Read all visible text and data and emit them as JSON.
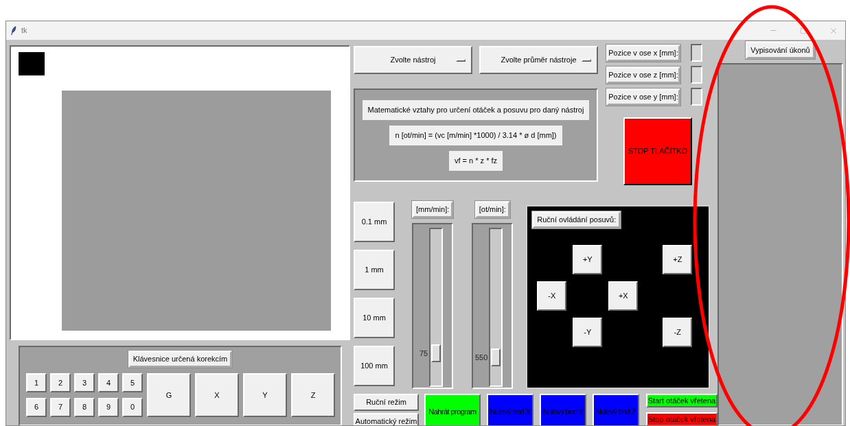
{
  "window": {
    "title": "tk"
  },
  "tool_dropdowns": [
    {
      "label": "Zvolte nástroj"
    },
    {
      "label": "Zvolte průměr nástroje"
    }
  ],
  "formulas": [
    "Matematické vztahy pro určení otáček a posuvu pro daný nástroj",
    "n [ot/min] = (vc [m/min] *1000) / 3.14 * ø d [mm])",
    "vf = n * z * fz"
  ],
  "positions": [
    {
      "label": "Pozice v ose x [mm]:"
    },
    {
      "label": "Pozice v ose z [mm]:"
    },
    {
      "label": "Pozice v ose y [mm]:"
    }
  ],
  "stop_button": "STOP TLAČÍTKO",
  "step_buttons": [
    "0.1 mm",
    "1 mm",
    "10 mm",
    "100 mm"
  ],
  "sliders": [
    {
      "unit": "[mm/min]:",
      "value": "75",
      "level": 0.83
    },
    {
      "unit": "[ot/min]:",
      "value": "550",
      "level": 0.86
    }
  ],
  "manual_jog": {
    "title": "Ruční ovládání posuvů:",
    "buttons": [
      "+Y",
      "+Z",
      "-X",
      "+X",
      "-Y",
      "-Z"
    ]
  },
  "keypad": {
    "title": "Klávesnice určená korekcím",
    "digit_keys": [
      "1",
      "2",
      "3",
      "4",
      "5",
      "6",
      "7",
      "8",
      "9",
      "0"
    ],
    "axis_keys": [
      "G",
      "X",
      "Y",
      "Z"
    ]
  },
  "mode_buttons": [
    "Ruční režim",
    "Automatický režim"
  ],
  "action_buttons": [
    {
      "label": "Nahrát program",
      "color": "#00ff00"
    },
    {
      "label": "Nulový bod X",
      "color": "#0000ff"
    },
    {
      "label": "Nulový bod Y",
      "color": "#0000ff"
    },
    {
      "label": "Nulový bod Z",
      "color": "#0000ff"
    }
  ],
  "spindle_buttons": [
    {
      "label": "Start otáček vřetena",
      "color": "#00ff00"
    },
    {
      "label": "Stop otáček vřetena",
      "color": "#ff0000"
    }
  ],
  "log": {
    "title": "Vypisování úkonů"
  }
}
